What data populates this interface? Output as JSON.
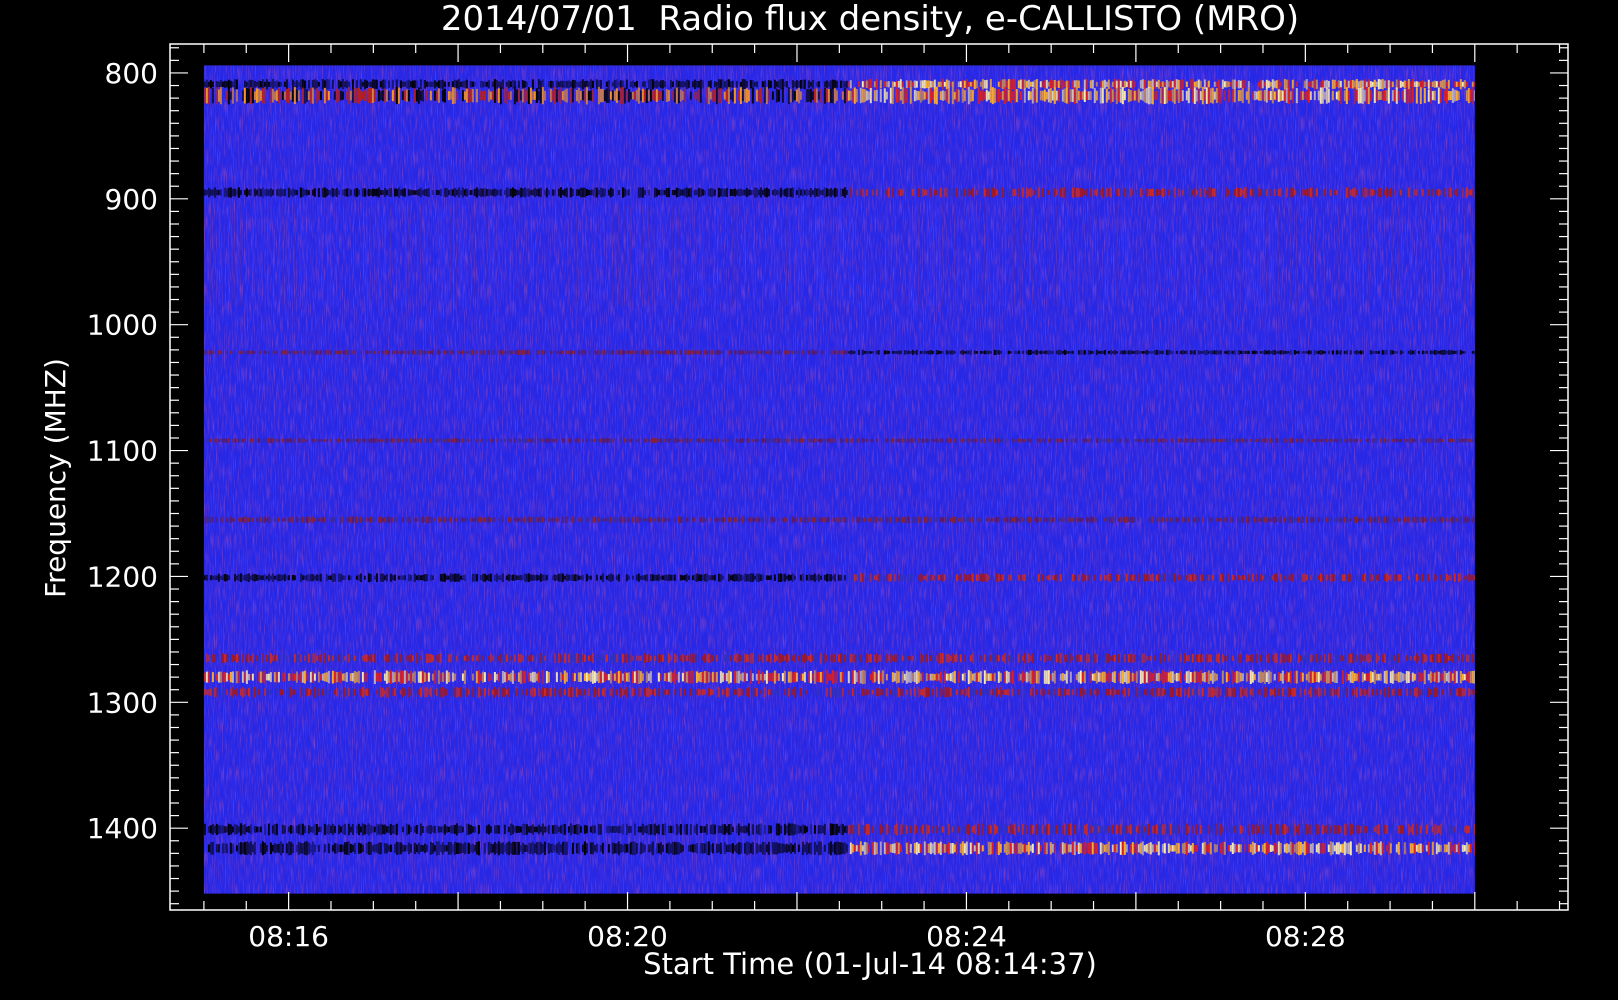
{
  "chart_data": {
    "type": "heatmap",
    "title": "2014/07/01  Radio flux density, e-CALLISTO (MRO)",
    "xlabel": "Start Time (01-Jul-14 08:14:37)",
    "ylabel": "Frequency (MHZ)",
    "x_ticks": [
      "08:16",
      "08:20",
      "08:24",
      "08:28"
    ],
    "x_tick_minutes": [
      16,
      20,
      24,
      28
    ],
    "x_range_minutes": [
      14.6,
      31.1
    ],
    "data_range_minutes": [
      15.0,
      30.0
    ],
    "y_ticks": [
      800,
      900,
      1000,
      1100,
      1200,
      1300,
      1400
    ],
    "y_range": [
      777,
      1465
    ],
    "data_y_range": [
      794,
      1452
    ],
    "y_inverted": true,
    "grid": false,
    "colormap": [
      "#000000",
      "#1a1aa0",
      "#2727e6",
      "#c81e1e",
      "#ff8c1e",
      "#ffffc8"
    ],
    "background_color": "#2727e6",
    "bands": [
      {
        "freq": 809,
        "width": 6,
        "before": "dark",
        "after": "bright"
      },
      {
        "freq": 818,
        "width": 10,
        "before": "mixed",
        "after": "bright"
      },
      {
        "freq": 895,
        "width": 6,
        "before": "dark",
        "after": "moderate"
      },
      {
        "freq": 1022,
        "width": 3,
        "before": "weak",
        "after": "dark"
      },
      {
        "freq": 1092,
        "width": 3,
        "before": "weak",
        "after": "weak"
      },
      {
        "freq": 1155,
        "width": 4,
        "before": "weak",
        "after": "weak"
      },
      {
        "freq": 1201,
        "width": 5,
        "before": "dark",
        "after": "moderate"
      },
      {
        "freq": 1265,
        "width": 6,
        "before": "moderate",
        "after": "moderate"
      },
      {
        "freq": 1280,
        "width": 8,
        "before": "bright",
        "after": "bright"
      },
      {
        "freq": 1292,
        "width": 6,
        "before": "moderate",
        "after": "moderate"
      },
      {
        "freq": 1401,
        "width": 7,
        "before": "dark",
        "after": "moderate"
      },
      {
        "freq": 1416,
        "width": 8,
        "before": "dark",
        "after": "bright"
      }
    ],
    "transition_minute": 22.6
  }
}
